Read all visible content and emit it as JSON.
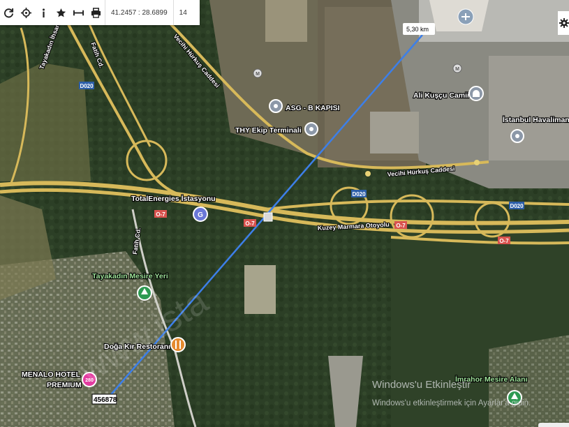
{
  "toolbar": {
    "buttons": [
      {
        "name": "refresh-icon"
      },
      {
        "name": "locate-icon"
      },
      {
        "name": "info-icon"
      },
      {
        "name": "star-icon"
      },
      {
        "name": "measure-icon"
      },
      {
        "name": "print-icon"
      }
    ],
    "coordinates": "41.2457 : 28.6899",
    "zoom": "14"
  },
  "map": {
    "measure_distance": "5,30 km",
    "plate_label": "456878",
    "watermark": "www.ista",
    "places": {
      "asg": "ASG - B KAPISI",
      "thy": "THY Ekip Terminali",
      "kuscu": "Ali Kuşçu Camii",
      "airport": "İstanbul Havalimanı",
      "total": "TotalEnergies İstasyonu",
      "tayakadin_mesire": "Tayakadın Mesire Yeri",
      "doga": "Doğa Kır Restoranı",
      "menalo_1": "MENALO HOTEL",
      "menalo_2": "PREMIUM",
      "imrahor": "İmrahor Mesire Alanı"
    },
    "roads": {
      "tayakadin_ihsaniye": "Tayakadın İhsaniye Cd.",
      "fatih_top": "Fatih Cd.",
      "fatih_mid": "Fatih Cd.",
      "vecihi_1": "Vecihi Hürkuş Caddesi",
      "vecihi_2": "Vecihi Hürkuş Caddesi",
      "kuzey": "Kuzey Marmara Otoyolu"
    },
    "shields": {
      "d020_a": "D020",
      "d020_b": "D020",
      "d020_c": "D020",
      "o7_a": "O-7",
      "o7_b": "O-7",
      "o7_c": "O-7",
      "o7_d": "O-7"
    },
    "metro_letter": "M",
    "gas_letter": "G",
    "hotel_badge": "280",
    "windows_1": "Windows'u Etkinleştir",
    "windows_2": "Windows'u etkinleştirmek için Ayarlar'a gidin."
  }
}
